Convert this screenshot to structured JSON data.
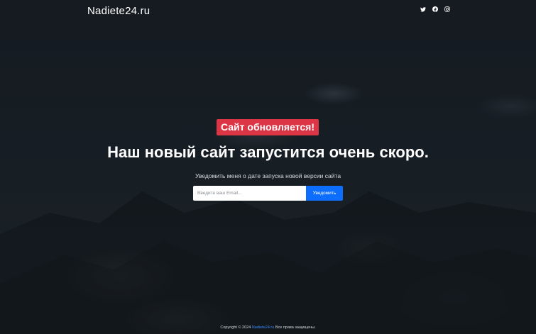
{
  "header": {
    "brand": "Nadiete24.ru",
    "social_icons": [
      "twitter-icon",
      "facebook-icon",
      "instagram-icon"
    ]
  },
  "hero": {
    "badge": "Сайт обновляется!",
    "headline": "Наш новый сайт запустится очень скоро.",
    "subtitle": "Уведомить меня о дате запуска новой версии сайта"
  },
  "form": {
    "email_placeholder": "Введите ваш Email...",
    "button_label": "Уведомить"
  },
  "footer": {
    "prefix": "Copyright © 2024",
    "link": "Nadiete24.ru",
    "suffix": "Все права защищены."
  },
  "colors": {
    "badge": "#dc3545",
    "button": "#0d6efd",
    "link": "#3d8bfd",
    "text": "#ffffff"
  }
}
